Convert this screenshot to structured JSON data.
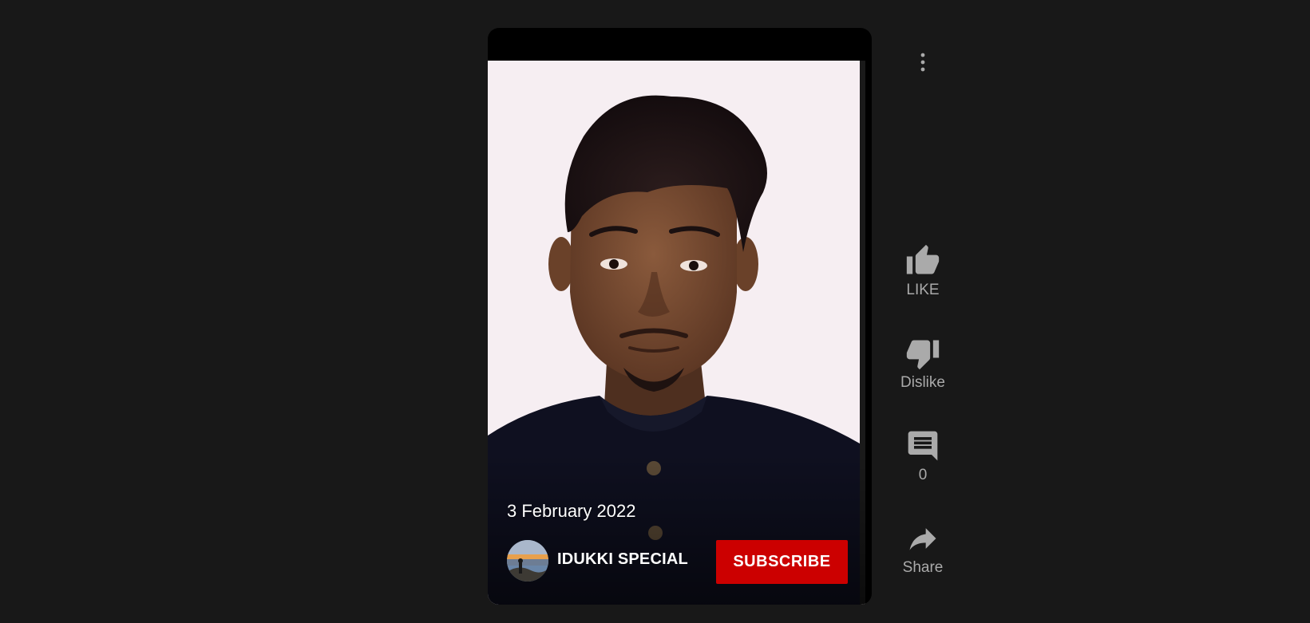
{
  "video": {
    "date": "3 February 2022"
  },
  "channel": {
    "name": "IDUKKI SPECIAL",
    "subscribe_label": "SUBSCRIBE"
  },
  "actions": {
    "like_label": "LIKE",
    "dislike_label": "Dislike",
    "comments_count": "0",
    "share_label": "Share"
  },
  "icons": {
    "more": "more-vert-icon",
    "like": "thumb-up-icon",
    "dislike": "thumb-down-icon",
    "comments": "comment-icon",
    "share": "share-arrow-icon"
  },
  "colors": {
    "background": "#181818",
    "subscribe": "#cc0000",
    "action_text": "#aaaaaa"
  }
}
